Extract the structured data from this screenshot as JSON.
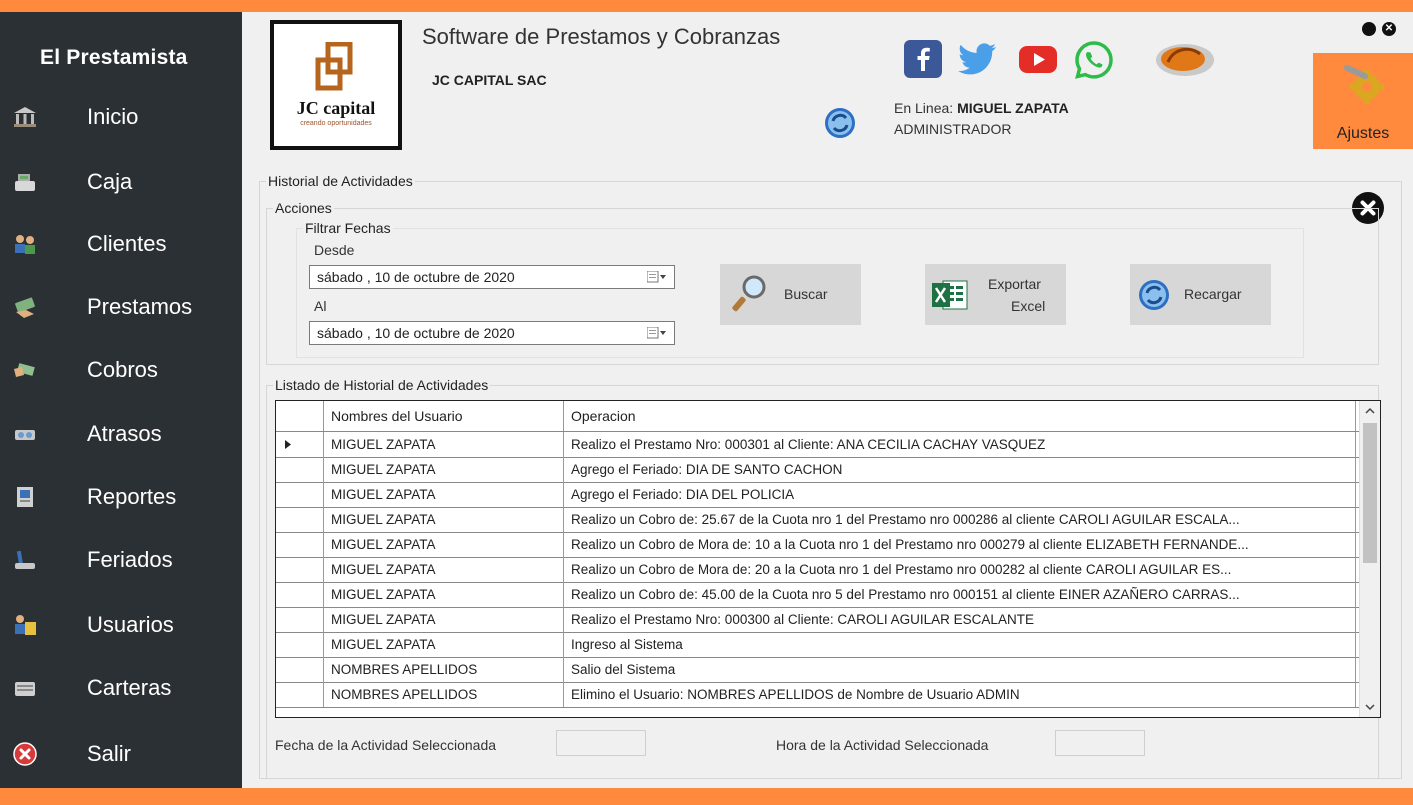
{
  "sidebar": {
    "brand": "El Prestamista",
    "items": [
      {
        "label": "Inicio",
        "icon": "bank-icon"
      },
      {
        "label": "Caja",
        "icon": "cash-register-icon"
      },
      {
        "label": "Clientes",
        "icon": "clients-icon"
      },
      {
        "label": "Prestamos",
        "icon": "loan-icon"
      },
      {
        "label": "Cobros",
        "icon": "payment-icon"
      },
      {
        "label": "Atrasos",
        "icon": "late-icon"
      },
      {
        "label": "Reportes",
        "icon": "report-icon"
      },
      {
        "label": "Feriados",
        "icon": "holiday-icon"
      },
      {
        "label": "Usuarios",
        "icon": "users-icon"
      },
      {
        "label": "Carteras",
        "icon": "wallet-icon"
      },
      {
        "label": "Salir",
        "icon": "exit-icon"
      }
    ]
  },
  "header": {
    "logo_text": "JC capital",
    "logo_sub": "creando oportunidades",
    "title": "Software de Prestamos y Cobranzas",
    "company": "JC CAPITAL SAC",
    "online_prefix": "En Linea: ",
    "online_user": "MIGUEL ZAPATA",
    "role": "ADMINISTRADOR",
    "settings_label": "Ajustes",
    "social_icons": [
      "facebook-icon",
      "twitter-icon",
      "youtube-icon",
      "whatsapp-icon",
      "mouse-icon"
    ]
  },
  "history": {
    "group_title": "Historial de Actividades",
    "actions_title": "Acciones",
    "filter_title": "Filtrar Fechas",
    "from_label": "Desde",
    "from_value": "sábado  , 10 de   octubre   de 2020",
    "to_label": "Al",
    "to_value": "sábado  , 10 de   octubre   de 2020",
    "buttons": {
      "search": "Buscar",
      "export_line1": "Exportar",
      "export_line2": "Excel",
      "reload": "Recargar"
    },
    "list_title": "Listado de Historial de Actividades",
    "columns": [
      "Nombres del Usuario",
      "Operacion"
    ],
    "rows": [
      {
        "user": "MIGUEL ZAPATA",
        "op": "Realizo el Prestamo Nro: 000301 al Cliente: ANA CECILIA CACHAY VASQUEZ"
      },
      {
        "user": "MIGUEL ZAPATA",
        "op": "Agrego el Feriado: DIA DE SANTO CACHON"
      },
      {
        "user": "MIGUEL ZAPATA",
        "op": "Agrego el Feriado: DIA DEL POLICIA"
      },
      {
        "user": "MIGUEL ZAPATA",
        "op": "Realizo un Cobro de: 25.67 de la Cuota nro 1 del Prestamo nro 000286 al cliente CAROLI AGUILAR ESCALA..."
      },
      {
        "user": "MIGUEL ZAPATA",
        "op": "Realizo un Cobro de Mora de: 10 a la Cuota nro 1 del Prestamo nro 000279 al cliente ELIZABETH FERNANDE..."
      },
      {
        "user": "MIGUEL ZAPATA",
        "op": "Realizo un Cobro de Mora de: 20 a la Cuota nro 1 del Prestamo nro 000282 al cliente CAROLI AGUILAR ES..."
      },
      {
        "user": "MIGUEL ZAPATA",
        "op": "Realizo un Cobro de: 45.00 de la Cuota nro 5 del Prestamo nro 000151 al cliente EINER AZAÑERO CARRAS..."
      },
      {
        "user": "MIGUEL ZAPATA",
        "op": "Realizo el Prestamo Nro: 000300 al Cliente: CAROLI AGUILAR ESCALANTE"
      },
      {
        "user": "MIGUEL ZAPATA",
        "op": "Ingreso al Sistema"
      },
      {
        "user": "NOMBRES APELLIDOS",
        "op": "Salio del Sistema"
      },
      {
        "user": "NOMBRES APELLIDOS",
        "op": "Elimino el Usuario: NOMBRES APELLIDOS de Nombre de Usuario ADMIN"
      }
    ],
    "date_label": "Fecha de la Actividad Seleccionada",
    "time_label": "Hora de la Actividad Seleccionada"
  },
  "colors": {
    "accent": "#ff8a3d",
    "sidebar": "#2b3035",
    "panel": "#f0f0f0"
  }
}
